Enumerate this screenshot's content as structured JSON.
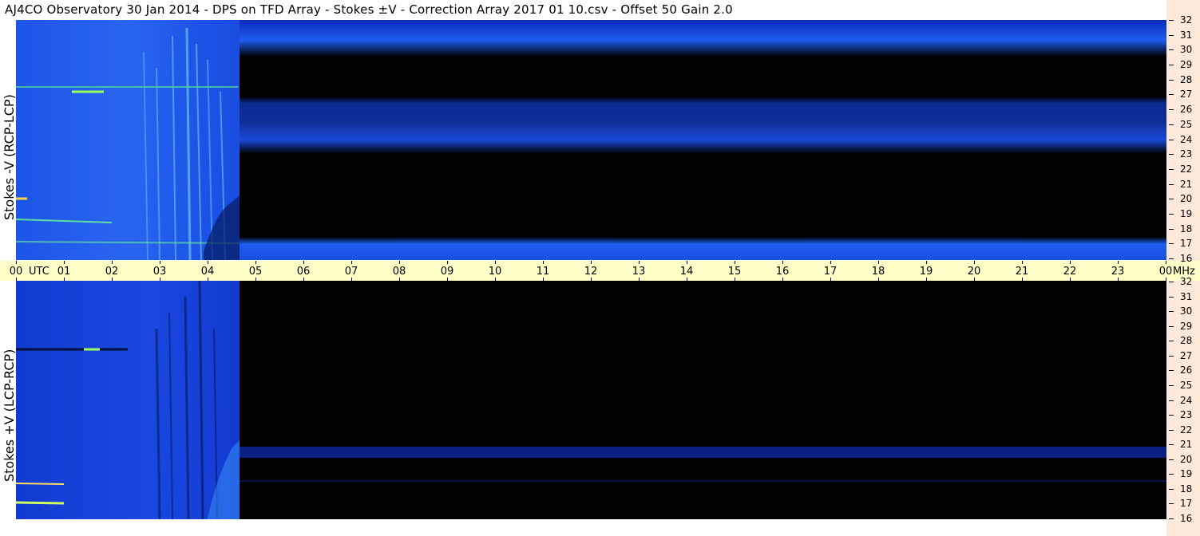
{
  "title": "AJ4CO Observatory  30 Jan 2014  -  DPS on TFD Array  -  Stokes ±V  -  Correction Array 2017 01 10.csv  -  Offset 50  Gain 2.0",
  "top_panel": {
    "label": "Stokes -V (RCP-LCP)"
  },
  "bottom_panel": {
    "label": "Stokes +V (LCP-RCP)"
  },
  "x_axis": {
    "unit_label": "UTC",
    "ticks": [
      "00",
      "01",
      "02",
      "03",
      "04",
      "05",
      "06",
      "07",
      "08",
      "09",
      "10",
      "11",
      "12",
      "13",
      "14",
      "15",
      "16",
      "17",
      "18",
      "19",
      "20",
      "21",
      "22",
      "23",
      "00"
    ]
  },
  "y_axis": {
    "unit_label": "MHz",
    "ticks": [
      "32",
      "31",
      "30",
      "29",
      "28",
      "27",
      "26",
      "25",
      "24",
      "23",
      "22",
      "21",
      "20",
      "19",
      "18",
      "17",
      "16"
    ]
  },
  "colors": {
    "background_dark": "#000000",
    "spectral_blue": "#1a4fe0",
    "axis_yellow": "#ffffc8",
    "axis_peach": "#fde9d9"
  }
}
